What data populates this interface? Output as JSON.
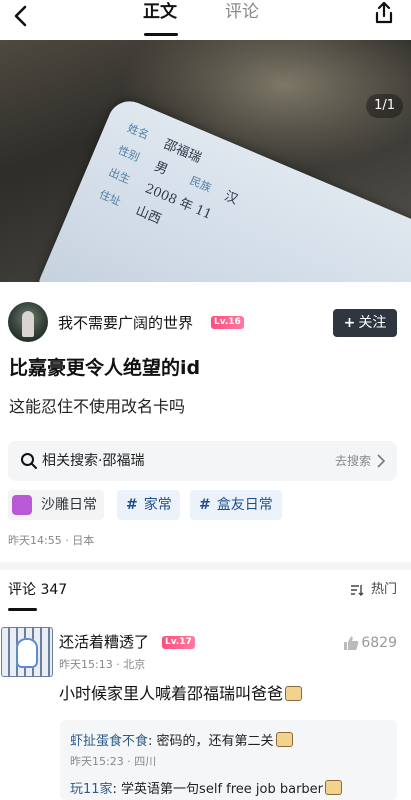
{
  "header": {
    "tab_main": "正文",
    "tab_comment": "评论"
  },
  "post": {
    "image_counter": "1/1",
    "card": {
      "label_name": "姓名",
      "name": "邵福瑞",
      "label_gender": "性别",
      "gender": "男",
      "label_ethnicity": "民族",
      "ethnicity": "汉",
      "label_birth": "出生",
      "birth": "2008 年 11",
      "label_address": "住址",
      "address": "山西"
    },
    "author": "我不需要广阔的世界",
    "author_level": "Lv.16",
    "follow_label": "关注",
    "title": "比嘉豪更令人绝望的id",
    "body": "这能忍住不使用改名卡吗",
    "related_search": "相关搜索·邵福瑞",
    "search_go": "去搜索",
    "tags": [
      {
        "label": "沙雕日常"
      },
      {
        "label": "家常"
      },
      {
        "label": "盒友日常"
      }
    ],
    "meta": "昨天14:55 · 日本"
  },
  "comments": {
    "title": "评论 347",
    "sort_label": "热门",
    "items": [
      {
        "name": "还活着糟透了",
        "level": "Lv.17",
        "likes": "6829",
        "meta": "昨天15:13 · 北京",
        "text": "小时候家里人喊着邵福瑞叫爸爸",
        "replies": [
          {
            "user": "虾扯蛋食不食",
            "text": ": 密码的，还有第二关",
            "meta": "昨天15:23 · 四川"
          },
          {
            "user": "玩11家",
            "text": ": 学英语第一句self free job barber",
            "meta": ""
          }
        ]
      }
    ]
  },
  "colors": {
    "level_badge": "#ff4d7d",
    "follow_bg": "#2f3640",
    "tag_text": "#1f4e8c",
    "reply_user": "#2e5c8a"
  }
}
